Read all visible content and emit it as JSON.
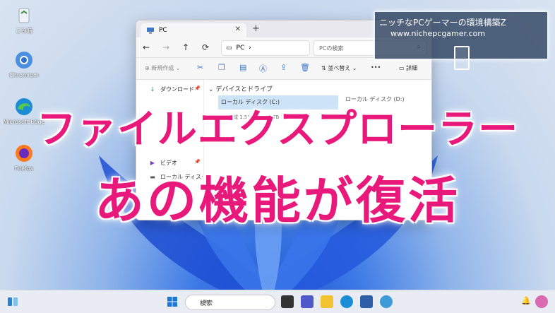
{
  "desktop": {
    "icons": [
      {
        "label": "ごみ箱",
        "icon": "recycle-bin-icon"
      },
      {
        "label": "Chromium",
        "icon": "chromium-icon"
      },
      {
        "label": "Microsoft Edge",
        "icon": "edge-icon"
      },
      {
        "label": "Firefox",
        "icon": "firefox-icon"
      }
    ]
  },
  "explorer": {
    "tab_title": "PC",
    "tab_close": "✕",
    "tab_new": "+",
    "address": "PC",
    "search_placeholder": "PCの検索",
    "toolbar": {
      "new_label": "新規作成",
      "sort_label": "並べ替え",
      "more_label": "•••",
      "details_label": "詳細"
    },
    "sidebar": [
      {
        "label": "ダウンロード",
        "icon": "download-icon"
      },
      {
        "label": "ビデオ",
        "icon": "video-icon"
      },
      {
        "label": "ローカル ディスク (C",
        "icon": "drive-icon"
      }
    ],
    "section_title": "デバイスとドライブ",
    "drive_label": "ローカル ディスク (C:)",
    "drive2_label": "ローカル ディスク (D:)",
    "drive_sub": "空き領域 1.51 TB/1.81 TB"
  },
  "taskbar": {
    "search_label": "検索"
  },
  "badge": {
    "title": "ニッチなPCゲーマーの環境構築Z",
    "url": "www.nichepcgamer.com"
  },
  "headline": {
    "line1": "ファイルエクスプローラー",
    "line2": "あの機能が復活"
  },
  "colors": {
    "headline": "#e8197a",
    "accent": "#3b78c8"
  }
}
